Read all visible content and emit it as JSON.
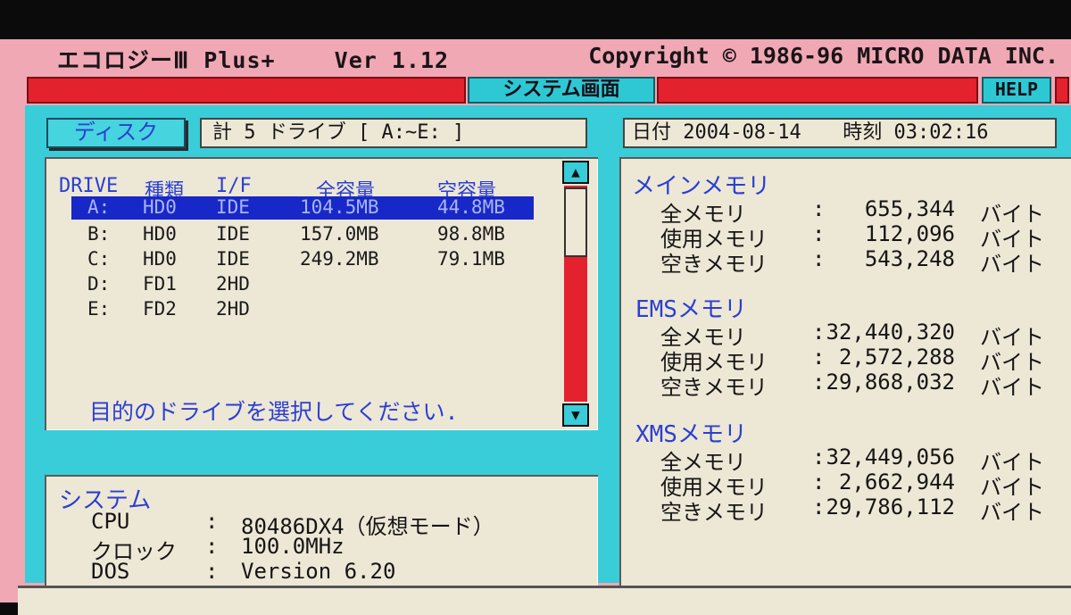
{
  "header": {
    "app_title": "エコロジーⅢ Plus+",
    "version": "Ver 1.12",
    "copyright": "Copyright © 1986-96  MICRO DATA INC."
  },
  "tabs": {
    "system_screen": "システム画面",
    "help": "HELP"
  },
  "disk": {
    "button": "ディスク",
    "summary": "計  5 ドライブ [ A:~E: ]",
    "columns": [
      "DRIVE",
      "種類",
      "I/F",
      "全容量",
      "空容量"
    ],
    "rows": [
      {
        "drive": "A:",
        "type": "HD0",
        "if": "IDE",
        "total": "104.5MB",
        "free": "44.8MB",
        "selected": true
      },
      {
        "drive": "B:",
        "type": "HD0",
        "if": "IDE",
        "total": "157.0MB",
        "free": "98.8MB"
      },
      {
        "drive": "C:",
        "type": "HD0",
        "if": "IDE",
        "total": "249.2MB",
        "free": "79.1MB"
      },
      {
        "drive": "D:",
        "type": "FD1",
        "if": "2HD",
        "total": "",
        "free": ""
      },
      {
        "drive": "E:",
        "type": "FD2",
        "if": "2HD",
        "total": "",
        "free": ""
      }
    ],
    "prompt": "目的のドライブを選択してください.",
    "scroll_up": "▲",
    "scroll_down": "▼"
  },
  "datetime": {
    "date_label": "日付",
    "date": "2004-08-14",
    "time_label": "時刻",
    "time": "03:02:16"
  },
  "system": {
    "title": "システム",
    "cpu_label": "CPU",
    "cpu": "80486DX4（仮想モード）",
    "clock_label": "クロック",
    "clock": "100.0MHz",
    "dos_label": "DOS",
    "dos": "Version 6.20"
  },
  "memory": {
    "main": {
      "title": "メインメモリ",
      "total_label": "全メモリ",
      "total": "655,344",
      "used_label": "使用メモリ",
      "used": "112,096",
      "free_label": "空きメモリ",
      "free": "543,248"
    },
    "ems": {
      "title": "EMSメモリ",
      "total_label": "全メモリ",
      "total": "32,440,320",
      "used_label": "使用メモリ",
      "used": "2,572,288",
      "free_label": "空きメモリ",
      "free": "29,868,032"
    },
    "xms": {
      "title": "XMSメモリ",
      "total_label": "全メモリ",
      "total": "32,449,056",
      "used_label": "使用メモリ",
      "used": "2,662,944",
      "free_label": "空きメモリ",
      "free": "29,786,112"
    },
    "unit": "バイト",
    "colon": ":"
  }
}
